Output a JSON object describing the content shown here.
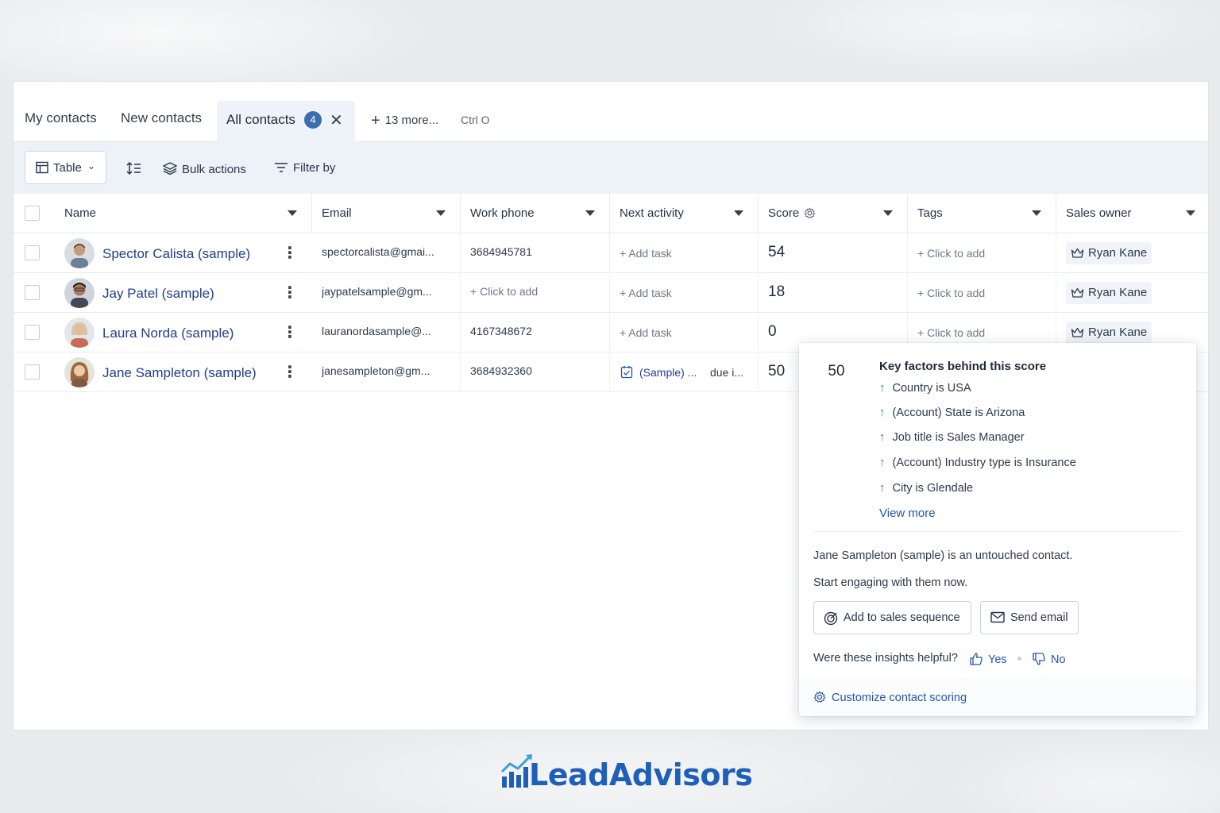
{
  "tabs": {
    "my_contacts": "My contacts",
    "new_contacts": "New contacts",
    "all_contacts": "All contacts",
    "all_contacts_count": "4",
    "more": "13 more...",
    "shortcut": "Ctrl O"
  },
  "toolbar": {
    "view": "Table",
    "bulk_actions": "Bulk actions",
    "filter_by": "Filter by"
  },
  "columns": {
    "name": "Name",
    "email": "Email",
    "work_phone": "Work phone",
    "next_activity": "Next activity",
    "score": "Score",
    "tags": "Tags",
    "sales_owner": "Sales owner"
  },
  "rows": [
    {
      "name": "Spector Calista (sample)",
      "email": "spectorcalista@gmai...",
      "phone": "3684945781",
      "activity": "+ Add task",
      "score": "54",
      "tags": "+ Click to add",
      "owner": "Ryan Kane"
    },
    {
      "name": "Jay Patel (sample)",
      "email": "jaypatelsample@gm...",
      "phone": "+ Click to add",
      "activity": "+ Add task",
      "score": "18",
      "tags": "+ Click to add",
      "owner": "Ryan Kane"
    },
    {
      "name": "Laura Norda (sample)",
      "email": "lauranordasample@...",
      "phone": "4167348672",
      "activity": "+ Add task",
      "score": "0",
      "tags": "+ Click to add",
      "owner": "Ryan Kane"
    },
    {
      "name": "Jane Sampleton (sample)",
      "email": "janesampleton@gm...",
      "phone": "3684932360",
      "activity": "(Sample) ...",
      "activity_due": "due i...",
      "score": "50"
    }
  ],
  "popover": {
    "score": "50",
    "title": "Key factors behind this score",
    "factors": [
      "Country is USA",
      "(Account) State is Arizona",
      "Job title is Sales Manager",
      "(Account) Industry type is Insurance",
      "City is Glendale"
    ],
    "view_more": "View more",
    "message_line1": "Jane Sampleton (sample) is an untouched contact.",
    "message_line2": "Start engaging with them now.",
    "add_sequence": "Add to sales sequence",
    "send_email": "Send email",
    "feedback_question": "Were these insights helpful?",
    "yes": "Yes",
    "no": "No",
    "customize": "Customize contact scoring"
  },
  "logo": {
    "text": "LeadAdvisors"
  },
  "colors": {
    "accent": "#2456a6",
    "link_name": "#22408a",
    "badge": "#3b6eb0",
    "toolbar_bg": "#edf2f9",
    "positive": "#1f8a6e"
  }
}
